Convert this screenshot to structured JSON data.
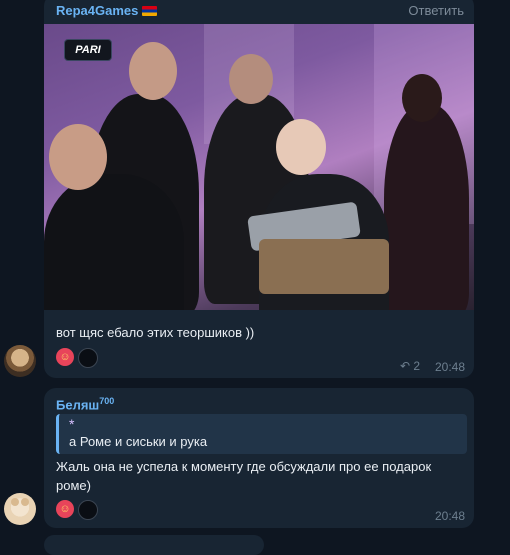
{
  "message1": {
    "sender": "Repa4Games",
    "sender_flag_icon": "armenia-flag-icon",
    "reply_label": "Ответить",
    "photo_logo": "PARI",
    "text": "вот щяс ебало этих теоршиков ))",
    "reactions": [
      "heart-face",
      "dark-bubble"
    ],
    "replies_count": "2",
    "time": "20:48"
  },
  "message2": {
    "sender": "Беляш",
    "sender_badge": "700",
    "quote_marker": "*",
    "quote_text": "а Роме и сиськи и рука",
    "text_line1": "Жаль она не успела к моменту где обсуждали про ее подарок",
    "text_line2": "роме)",
    "reactions": [
      "heart-face",
      "dark-bubble"
    ],
    "time": "20:48"
  },
  "colors": {
    "background": "#0e1621",
    "bubble": "#182533",
    "accent": "#6ab3f3",
    "meta": "#6d7f8f"
  }
}
